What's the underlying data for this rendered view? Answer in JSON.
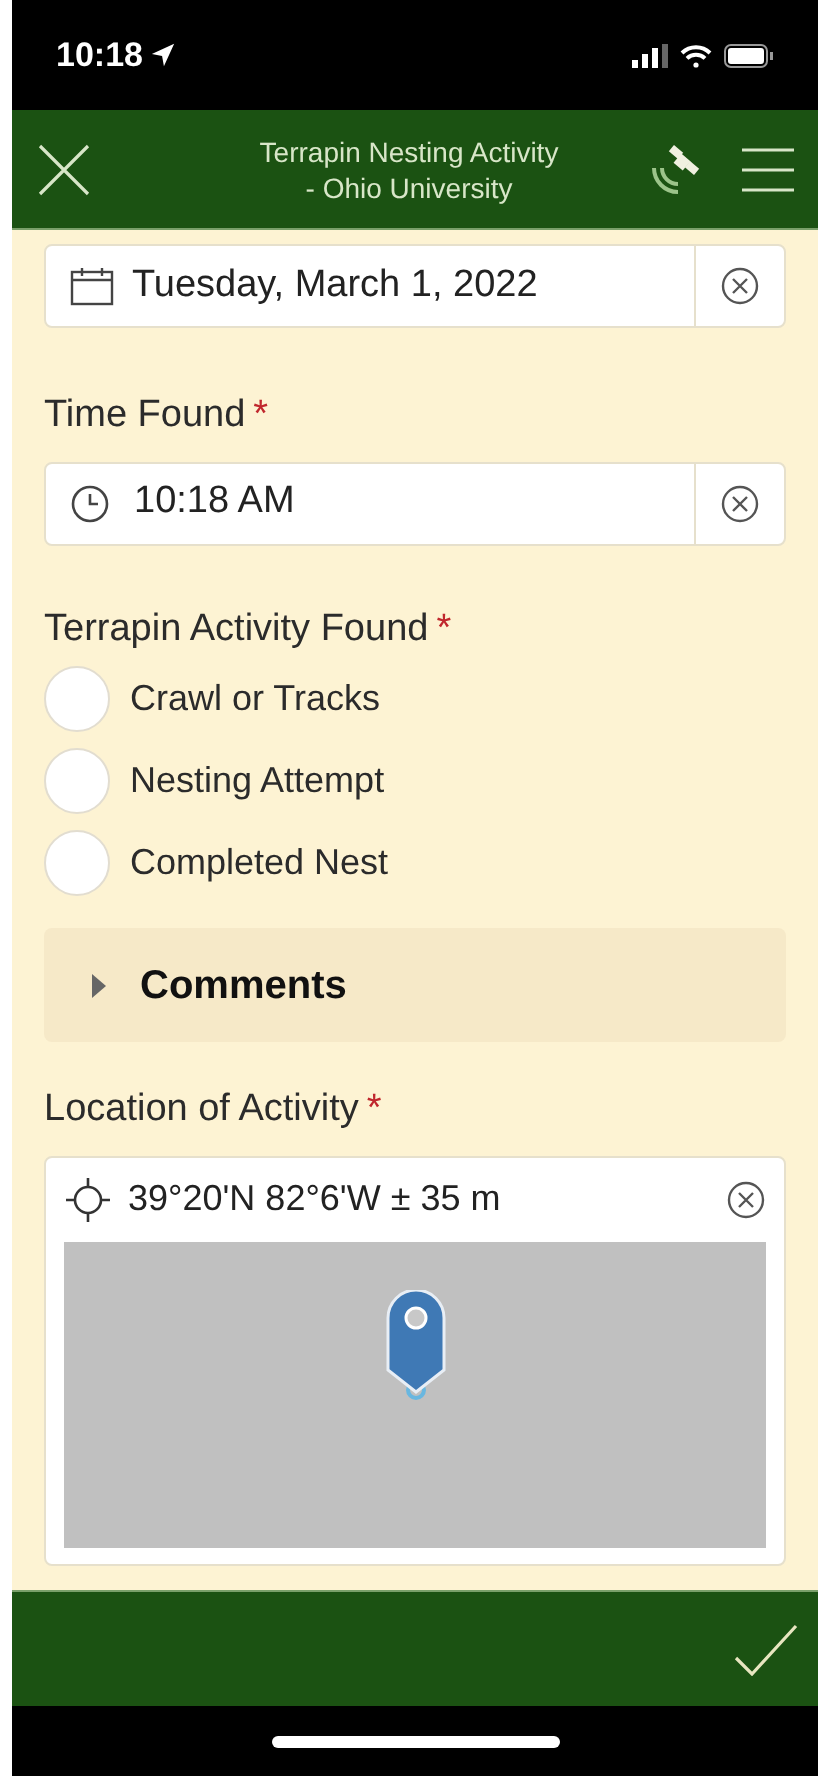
{
  "status_bar": {
    "time": "10:18"
  },
  "header": {
    "title": "Terrapin Nesting Activity\n - Ohio University"
  },
  "date_field": {
    "value": "Tuesday, March 1, 2022"
  },
  "time_found": {
    "label": "Time Found",
    "required_mark": "*",
    "value": "10:18 AM"
  },
  "activity": {
    "label": "Terrapin Activity Found",
    "required_mark": "*",
    "options": [
      {
        "label": "Crawl or Tracks",
        "selected": false
      },
      {
        "label": "Nesting Attempt",
        "selected": false
      },
      {
        "label": "Completed Nest",
        "selected": false
      }
    ]
  },
  "comments": {
    "label": "Comments",
    "expanded": false
  },
  "location": {
    "label": "Location of Activity",
    "required_mark": "*",
    "value": "39°20'N 82°6'W ± 35 m"
  }
}
